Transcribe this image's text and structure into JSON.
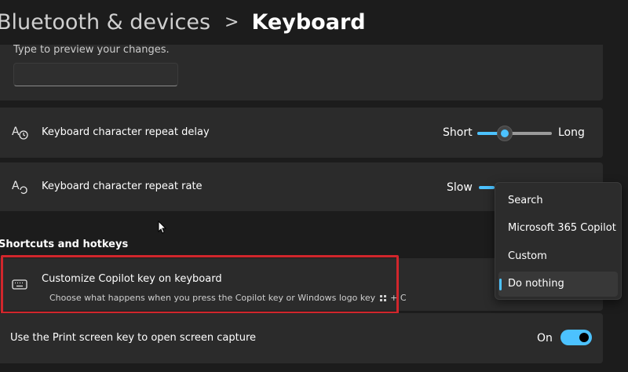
{
  "breadcrumb": {
    "parent": "Bluetooth & devices",
    "separator": ">",
    "current": "Keyboard"
  },
  "preview": {
    "hint": "Type to preview your changes.",
    "input_value": ""
  },
  "settings": {
    "repeat_delay": {
      "label": "Keyboard character repeat delay",
      "left": "Short",
      "right": "Long",
      "value_fraction": 0.37
    },
    "repeat_rate": {
      "label": "Keyboard character repeat rate",
      "left": "Slow"
    }
  },
  "section": {
    "heading": "Shortcuts and hotkeys"
  },
  "copilot": {
    "title": "Customize Copilot key on keyboard",
    "subtitle_pre": "Choose what happens when you press the Copilot key or Windows logo key",
    "subtitle_post": "+ C"
  },
  "print_screen": {
    "label": "Use the Print screen key to open screen capture",
    "state": "On"
  },
  "dropdown": {
    "options": [
      "Search",
      "Microsoft 365 Copilot",
      "Custom",
      "Do nothing"
    ],
    "selected": "Do nothing"
  },
  "colors": {
    "accent": "#4cc2ff",
    "highlight": "#d1262c"
  },
  "icons": {
    "repeat_delay": "keyboard-delay-icon",
    "repeat_rate": "keyboard-rate-icon",
    "copilot": "keyboard-icon",
    "windows_logo": "windows-logo-icon"
  }
}
